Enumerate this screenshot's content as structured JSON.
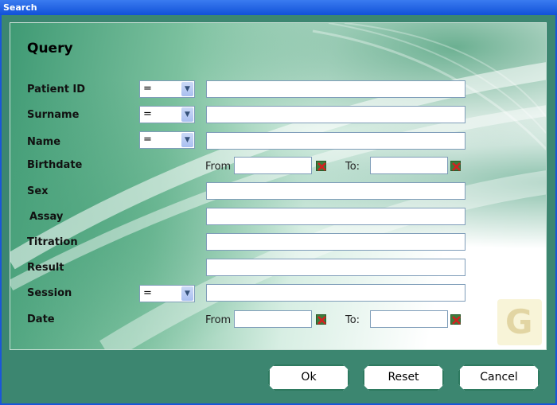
{
  "window": {
    "title": "Search"
  },
  "form": {
    "heading": "Query",
    "rows": {
      "patient_id": {
        "label": "Patient ID",
        "operator": "=",
        "value": ""
      },
      "surname": {
        "label": "Surname",
        "operator": "=",
        "value": ""
      },
      "name": {
        "label": "Name",
        "operator": "=",
        "value": ""
      },
      "birthdate": {
        "label": "Birthdate",
        "from_label": "From",
        "to_label": "To:",
        "from_value": "",
        "to_value": ""
      },
      "sex": {
        "label": "Sex",
        "value": ""
      },
      "assay": {
        "label": "Assay",
        "value": ""
      },
      "titration": {
        "label": "Titration",
        "value": ""
      },
      "result": {
        "label": "Result",
        "value": ""
      },
      "session": {
        "label": "Session",
        "operator": "=",
        "value": ""
      },
      "date": {
        "label": "Date",
        "from_label": "From",
        "to_label": "To:",
        "from_value": "",
        "to_value": ""
      }
    }
  },
  "buttons": {
    "ok": "Ok",
    "reset": "Reset",
    "cancel": "Cancel"
  },
  "icons": {
    "dropdown": "chevron-down-icon",
    "clear": "clear-x-icon",
    "logo": "g-logo-icon"
  },
  "colors": {
    "frame": "#3c8670",
    "titlebar": "#1151d8",
    "accent_green": "#2e7a60",
    "clear_red": "#d42020"
  }
}
